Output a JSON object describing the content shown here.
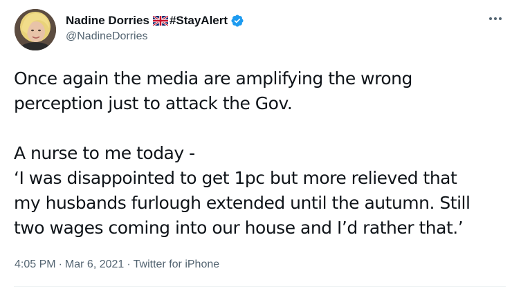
{
  "author": {
    "display_name": "Nadine Dorries",
    "hashtag": "#StayAlert",
    "handle": "@NadineDorries",
    "flag_icon": "uk-flag-icon",
    "verified_icon": "verified-badge-icon"
  },
  "more_icon": "more-options-icon",
  "tweet": {
    "text": "Once again the media are amplifying the wrong\nperception just to attack the Gov.\n\nA nurse to me today -\n‘I was disappointed to get 1pc but more relieved that\nmy husbands furlough extended until the autumn. Still\ntwo wages coming into our house and I’d rather that.’"
  },
  "meta": {
    "time": "4:05 PM",
    "date": "Mar 6, 2021",
    "source": "Twitter for iPhone",
    "separator": "·"
  },
  "colors": {
    "text": "#0f1419",
    "secondary": "#536471",
    "verified": "#1d9bf0",
    "divider": "#eff3f4"
  }
}
